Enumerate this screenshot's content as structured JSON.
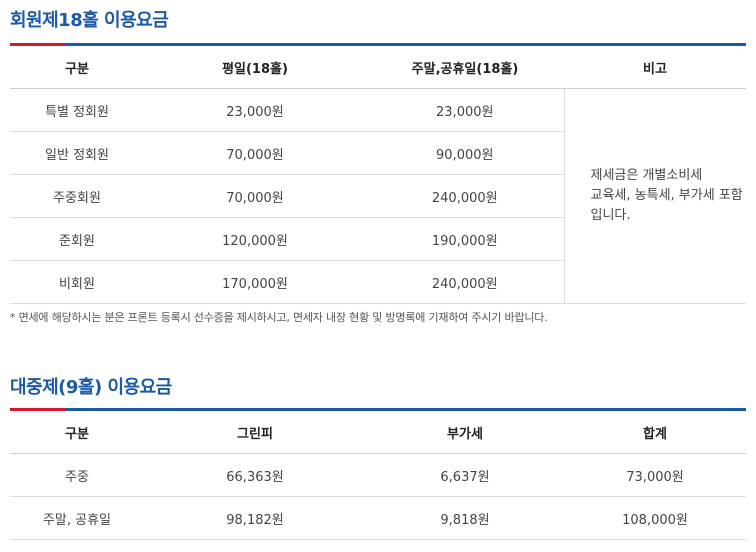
{
  "member_section": {
    "title": "회원제18홀 이용요금",
    "headers": [
      "구분",
      "평일(18홀)",
      "주말,공휴일(18홀)",
      "비고"
    ],
    "rows": [
      [
        "특별 정회원",
        "23,000원",
        "23,000원"
      ],
      [
        "일반 정회원",
        "70,000원",
        "90,000원"
      ],
      [
        "주중회원",
        "70,000원",
        "240,000원"
      ],
      [
        "준회원",
        "120,000원",
        "190,000원"
      ],
      [
        "비회원",
        "170,000원",
        "240,000원"
      ]
    ],
    "note_lines": [
      "제세금은 개별소비세",
      "교육세, 농특세, 부가세 포함",
      "입니다."
    ],
    "footnote": "* 면세에 해당하시는 분은 프론트 등록시 선수증을 제시하시고, 면세자 내장 현황 및 방명록에 기재하여 주시기 바랍니다."
  },
  "public_section": {
    "title": "대중제(9홀) 이용요금",
    "headers": [
      "구분",
      "그린피",
      "부가세",
      "합계"
    ],
    "rows": [
      [
        "주중",
        "66,363원",
        "6,637원",
        "73,000원"
      ],
      [
        "주말, 공휴일",
        "98,182원",
        "9,818원",
        "108,000원"
      ]
    ]
  },
  "colors": {
    "accent_blue": "#1a5aa6",
    "accent_red": "#d7182a"
  }
}
